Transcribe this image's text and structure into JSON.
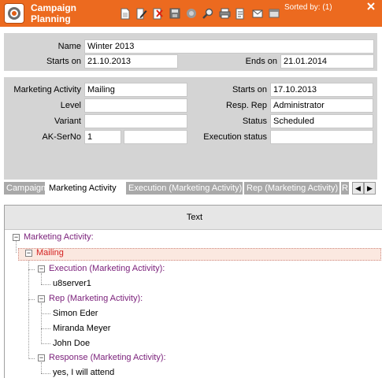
{
  "app": {
    "title_line1": "Campaign",
    "title_line2": "Planning",
    "sorted_by": "Sorted by: (1)"
  },
  "toolbar": {
    "icons": [
      "new-document-icon",
      "edit-icon",
      "delete-icon",
      "save-icon",
      "refresh-icon",
      "search-icon",
      "print-icon",
      "export-icon",
      "mail-icon",
      "window-icon"
    ]
  },
  "campaign": {
    "name_label": "Name",
    "name_value": "Winter 2013",
    "starts_label": "Starts on",
    "starts_value": "21.10.2013",
    "ends_label": "Ends on",
    "ends_value": "21.01.2014"
  },
  "activity": {
    "marketing_activity_label": "Marketing Activity",
    "marketing_activity_value": "Mailing",
    "level_label": "Level",
    "level_value": "",
    "variant_label": "Variant",
    "variant_value": "",
    "ak_serno_label": "AK-SerNo",
    "ak_serno_value": "1",
    "ak_serno_extra": "",
    "starts_label": "Starts on",
    "starts_value": "17.10.2013",
    "resp_rep_label": "Resp. Rep",
    "resp_rep_value": "Administrator",
    "status_label": "Status",
    "status_value": "Scheduled",
    "execution_status_label": "Execution status",
    "execution_status_value": ""
  },
  "tabs": [
    {
      "label": "Campaign"
    },
    {
      "label": "Marketing Activity"
    },
    {
      "label": "Execution (Marketing Activity)"
    },
    {
      "label": "Rep (Marketing Activity)"
    },
    {
      "label": "R"
    }
  ],
  "tree": {
    "column_header": "Text",
    "root": "Marketing Activity:",
    "mailing": "Mailing",
    "execution": "Execution (Marketing Activity):",
    "server": "u8server1",
    "rep": "Rep (Marketing Activity):",
    "rep1": "Simon Eder",
    "rep2": "Miranda Meyer",
    "rep3": "John Doe",
    "response": "Response (Marketing Activity):",
    "response1": "yes, I will attend"
  },
  "colors": {
    "titlebar": "#ec6a1f",
    "panel": "#d4d4d4",
    "tree_purple": "#7a1f7a",
    "tree_selected_red": "#d42020"
  }
}
